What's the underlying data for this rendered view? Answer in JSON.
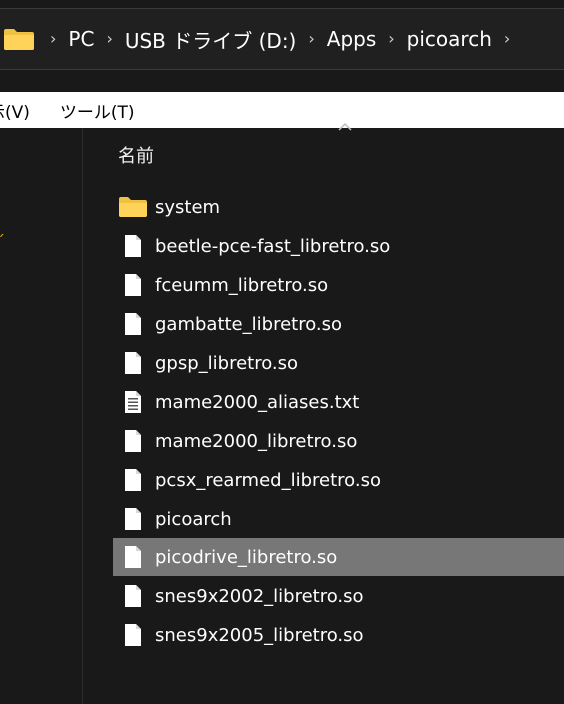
{
  "address": {
    "crumbs": [
      "PC",
      "USB ドライブ (D:)",
      "Apps",
      "picoarch"
    ],
    "folder_icon": "folder-icon",
    "separator_icon": "chevron-right-icon"
  },
  "menu": {
    "view": "示(V)",
    "tools": "ツール(T)"
  },
  "list": {
    "column_name": "名前",
    "sort_icon": "sort-up-icon",
    "items": [
      {
        "name": "system",
        "icon": "folder-icon"
      },
      {
        "name": "beetle-pce-fast_libretro.so",
        "icon": "file-icon"
      },
      {
        "name": "fceumm_libretro.so",
        "icon": "file-icon"
      },
      {
        "name": "gambatte_libretro.so",
        "icon": "file-icon"
      },
      {
        "name": "gpsp_libretro.so",
        "icon": "file-icon"
      },
      {
        "name": "mame2000_aliases.txt",
        "icon": "text-file-icon"
      },
      {
        "name": "mame2000_libretro.so",
        "icon": "file-icon"
      },
      {
        "name": "pcsx_rearmed_libretro.so",
        "icon": "file-icon"
      },
      {
        "name": "picoarch",
        "icon": "file-icon"
      },
      {
        "name": "picodrive_libretro.so",
        "icon": "file-icon",
        "selected": true
      },
      {
        "name": "snes9x2002_libretro.so",
        "icon": "file-icon"
      },
      {
        "name": "snes9x2005_libretro.so",
        "icon": "file-icon"
      }
    ]
  },
  "colors": {
    "background": "#191919",
    "selection": "#777777",
    "folder": "#f0c040"
  }
}
